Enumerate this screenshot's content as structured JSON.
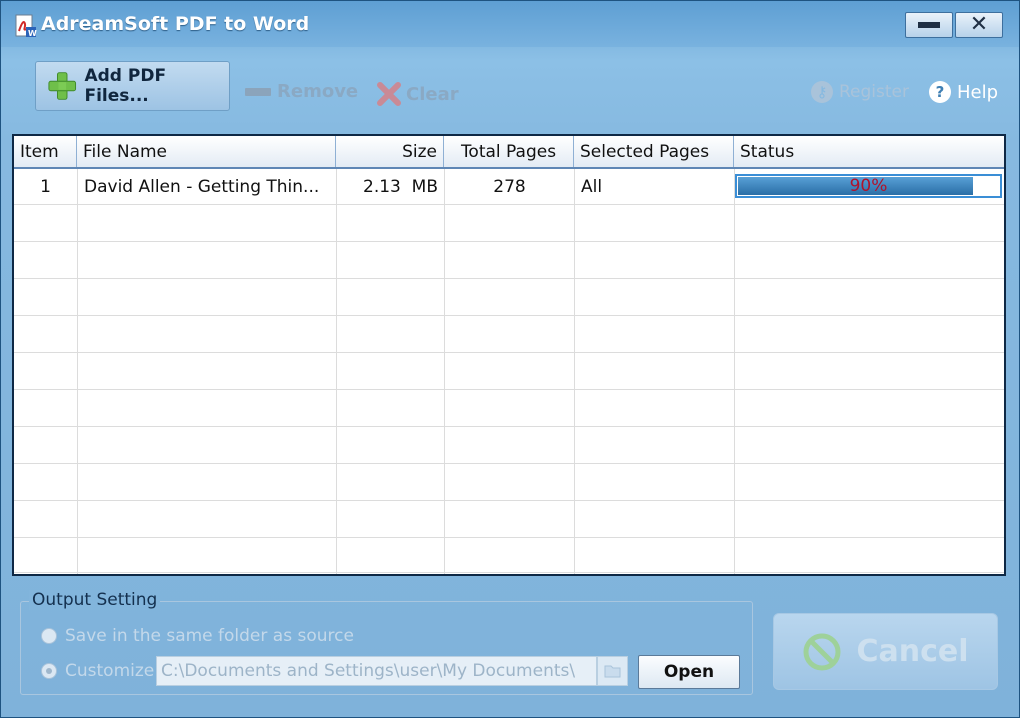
{
  "window": {
    "title": "AdreamSoft PDF to Word"
  },
  "toolbar": {
    "add_label": "Add PDF Files...",
    "remove_label": "Remove",
    "clear_label": "Clear",
    "register_label": "Register",
    "help_label": "Help"
  },
  "table": {
    "columns": [
      "Item",
      "File Name",
      "Size",
      "Total Pages",
      "Selected Pages",
      "Status"
    ],
    "rows": [
      {
        "item": "1",
        "file_name": "David Allen - Getting Thin...",
        "size": "2.13  MB",
        "total_pages": "278",
        "selected_pages": "All",
        "status_text": "90%",
        "progress": 0.9
      }
    ]
  },
  "output": {
    "legend": "Output Setting",
    "option_same_folder": "Save in the same folder as source",
    "option_customize": "Customize",
    "path_value": "C:\\Documents and Settings\\user\\My Documents\\",
    "open_label": "Open"
  },
  "actions": {
    "cancel_label": "Cancel"
  },
  "colors": {
    "accent": "#2a6ea6",
    "progress_text": "#b2122a",
    "window_bg": "#86b9e0"
  }
}
